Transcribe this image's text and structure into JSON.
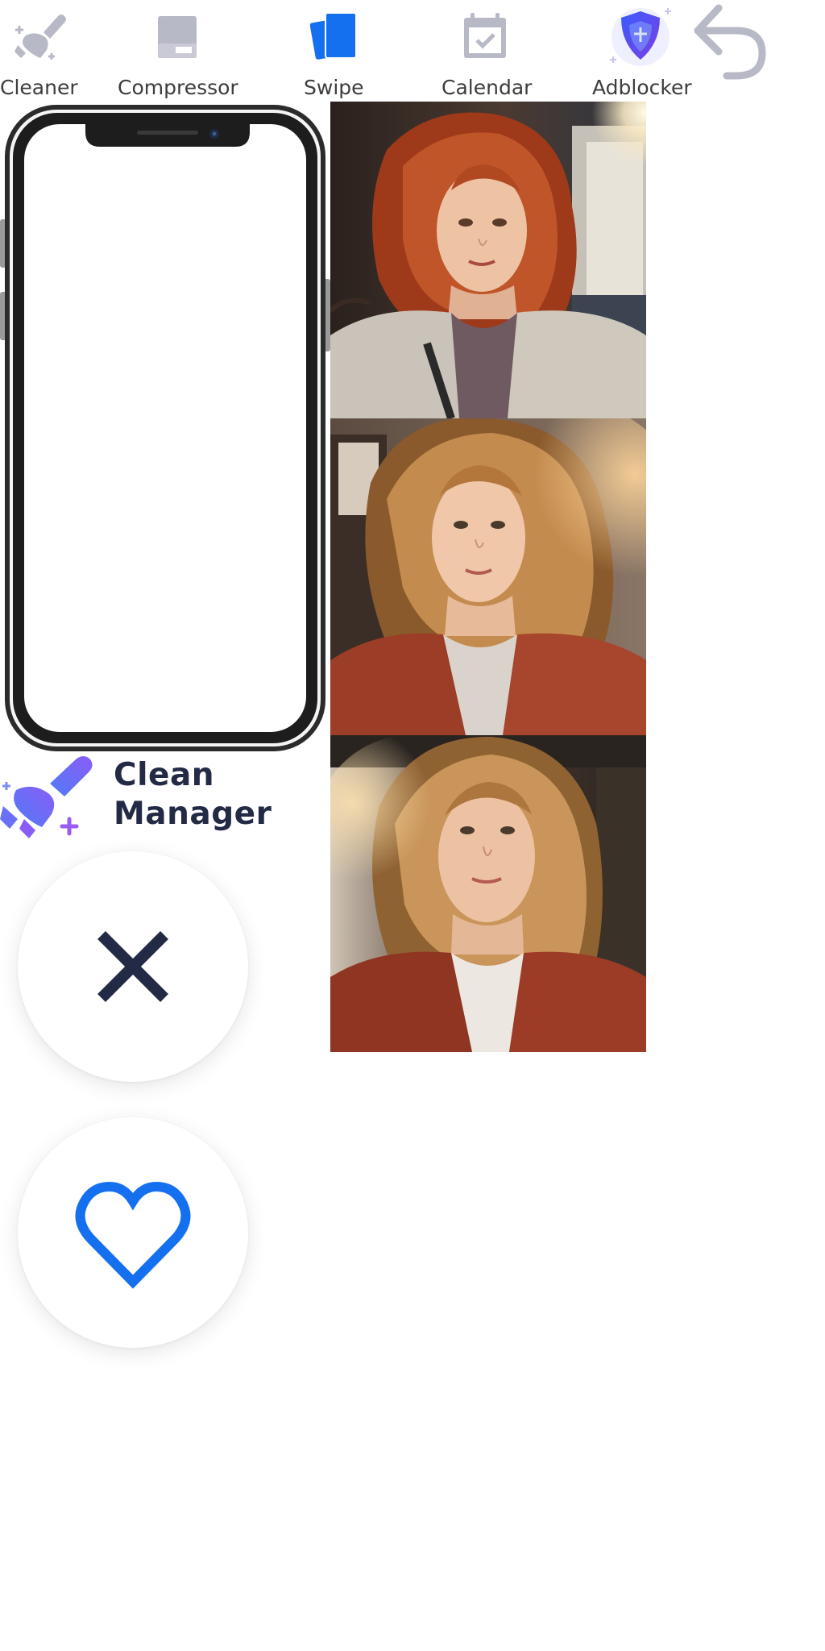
{
  "nav": {
    "items": [
      {
        "label": "Cleaner",
        "icon": "broom-icon",
        "active": false
      },
      {
        "label": "Compressor",
        "icon": "compress-drive-icon",
        "active": false
      },
      {
        "label": "Swipe",
        "icon": "swipe-cards-icon",
        "active": true
      },
      {
        "label": "Calendar",
        "icon": "calendar-check-icon",
        "active": false
      },
      {
        "label": "Adblocker",
        "icon": "shield-icon",
        "active": false
      }
    ],
    "undo_icon": "undo-icon"
  },
  "brand": {
    "line1": "Clean",
    "line2": "Manager",
    "logo_icon": "brush-logo-icon"
  },
  "photos": [
    {
      "subject": "selfie-red-curly-hair"
    },
    {
      "subject": "selfie-blonde-curly-hair"
    },
    {
      "subject": "selfie-blonde-curly-hair-close"
    }
  ],
  "actions": {
    "reject_icon": "close-icon",
    "keep_icon": "heart-icon"
  },
  "colors": {
    "accent_blue": "#1570ef",
    "inactive_icon": "#b8b9c6",
    "label_text": "#3d3d3d",
    "brand_text": "#232a45",
    "reject_x": "#232a45",
    "heart": "#1570ef",
    "logo_gradient_start": "#5a6cf5",
    "logo_gradient_end": "#a855f7"
  }
}
